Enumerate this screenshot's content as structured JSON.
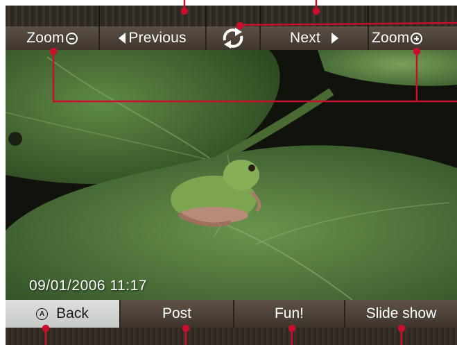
{
  "toolbar": {
    "zoom_out_label": "Zoom",
    "previous_label": "Previous",
    "next_label": "Next",
    "zoom_in_label": "Zoom"
  },
  "photo": {
    "date": "09/01/2006 11:17"
  },
  "bottombar": {
    "back_badge": "A",
    "back_label": "Back",
    "post_label": "Post",
    "fun_label": "Fun!",
    "slideshow_label": "Slide show"
  },
  "colors": {
    "callout": "#c8102e",
    "toolbar_bg": "#4d433a",
    "back_bg": "#d3d6d4"
  },
  "icons": {
    "rotate": "rotate-icon",
    "zoom_out": "minus-circle-icon",
    "zoom_in": "plus-circle-icon",
    "back_badge": "a-button-icon"
  }
}
